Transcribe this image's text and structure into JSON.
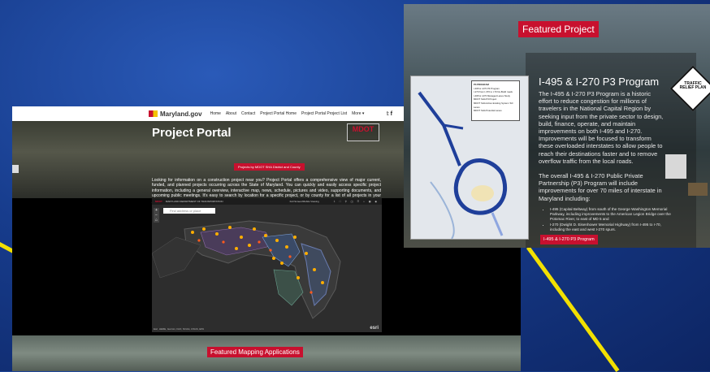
{
  "colors": {
    "accent": "#c8102e",
    "stripe": "#f2e000",
    "background": "#173c8c"
  },
  "portal": {
    "site_logo": "Maryland.gov",
    "nav": [
      "Home",
      "About",
      "Contact",
      "Project Portal Home",
      "Project Portal Project List",
      "More"
    ],
    "social_icons": [
      "twitter-icon",
      "facebook-icon"
    ],
    "title": "Project Portal",
    "agency_logo": "MDOT",
    "filter_button": "Projects by MDOT SHA District and County",
    "description": "Looking for information on a construction project near you? Project Portal offers a comprehensive view of major current, funded, and planned projects occurring across the State of Maryland. You can quickly and easily access specific project information, including a general overview, interactive map, news, schedule, pictures and video, supporting documents, and upcoming public meetings. It's easy to search by location for a specific project, or by county for a list of all projects in your jurisdiction.",
    "map": {
      "header_left": "MARYLAND DEPARTMENT OF TRANSPORTATION",
      "title": "Full Screen/Mobile Viewing",
      "search_placeholder": "Find address or place",
      "attribution": "Esri, HERE, Garmin, FAO, NOAA, USGS, EPA",
      "esri": "esri"
    },
    "featured_label": "Featured Mapping Applications"
  },
  "featured": {
    "heading": "Featured Project",
    "title": "I-495 & I-270 P3 Program",
    "para1": "The I-495 & I-270 P3 Program is a historic effort to reduce congestion for millions of travelers in the National Capital Region by seeking input from the private sector to design, build, finance, operate, and maintain improvements on both I-495 and I-270. Improvements will be focused to transform these overloaded interstates to allow people to reach their destinations faster and to remove overflow traffic from the local roads.",
    "para2": "The overall I-495 & I-270 Public Private Partnership (P3) Program will include improvements for over 70 miles of interstate in Maryland including:",
    "bullets": [
      "I-495 (Capital Beltway) from south of the George Washington Memorial Parkway, including improvements to the American Legion Bridge over the Potomac River, to east of MD 5 and",
      "I-270 (Dwight D. Eisenhower Memorial Highway) from I-495 to I-70, including the east and west I-270 spurs."
    ],
    "button": "I-495 & I-270 P3 Program",
    "map_legend_title": "P3 PROGRAM",
    "map_legend": [
      "I-495 & I-270 P3 Program",
      "I-270 from I-370 to I-70 No-Build roads",
      "I-495 & I-270 Managed Lanes Study",
      "MDOT SHA P3 Project",
      "MDOT SHA Active Existing System Toll Lanes",
      "MDOT SHA Potential Lanes"
    ],
    "sign_text": "TRAFFIC RELIEF PLAN"
  }
}
